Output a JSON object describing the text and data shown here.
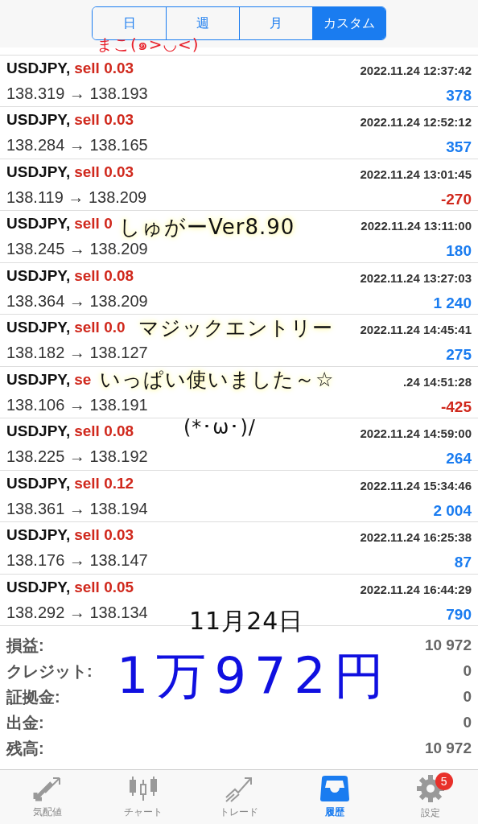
{
  "period_tabs": [
    {
      "label": "日",
      "selected": false
    },
    {
      "label": "週",
      "selected": false
    },
    {
      "label": "月",
      "selected": false
    },
    {
      "label": "カスタム",
      "selected": true
    }
  ],
  "deals": [
    {
      "symbol": "USDJPY,",
      "side": "sell 0.03",
      "time": "2022.11.24 12:37:42",
      "prices": "138.319 → 138.193",
      "profit": "378",
      "negative": false
    },
    {
      "symbol": "USDJPY,",
      "side": "sell 0.03",
      "time": "2022.11.24 12:52:12",
      "prices": "138.284 → 138.165",
      "profit": "357",
      "negative": false
    },
    {
      "symbol": "USDJPY,",
      "side": "sell 0.03",
      "time": "2022.11.24 13:01:45",
      "prices": "138.119 → 138.209",
      "profit": "-270",
      "negative": true
    },
    {
      "symbol": "USDJPY,",
      "side": "sell 0",
      "time": "2022.11.24 13:11:00",
      "prices": "138.245 → 138.209",
      "profit": "180",
      "negative": false
    },
    {
      "symbol": "USDJPY,",
      "side": "sell 0.08",
      "time": "2022.11.24 13:27:03",
      "prices": "138.364 → 138.209",
      "profit": "1 240",
      "negative": false
    },
    {
      "symbol": "USDJPY,",
      "side": "sell 0.0",
      "time": "2022.11.24 14:45:41",
      "prices": "138.182 → 138.127",
      "profit": "275",
      "negative": false
    },
    {
      "symbol": "USDJPY,",
      "side": "se",
      "time": ".24 14:51:28",
      "prices": "138.106 → 138.191",
      "profit": "-425",
      "negative": true
    },
    {
      "symbol": "USDJPY,",
      "side": "sell 0.08",
      "time": "2022.11.24 14:59:00",
      "prices": "138.225 → 138.192",
      "profit": "264",
      "negative": false
    },
    {
      "symbol": "USDJPY,",
      "side": "sell 0.12",
      "time": "2022.11.24 15:34:46",
      "prices": "138.361 → 138.194",
      "profit": "2 004",
      "negative": false
    },
    {
      "symbol": "USDJPY,",
      "side": "sell 0.03",
      "time": "2022.11.24 16:25:38",
      "prices": "138.176 → 138.147",
      "profit": "87",
      "negative": false
    },
    {
      "symbol": "USDJPY,",
      "side": "sell 0.05",
      "time": "2022.11.24 16:44:29",
      "prices": "138.292 → 138.134",
      "profit": "790",
      "negative": false
    }
  ],
  "summary": [
    {
      "label": "損益:",
      "value": "10 972"
    },
    {
      "label": "クレジット:",
      "value": "0"
    },
    {
      "label": "証拠金:",
      "value": "0"
    },
    {
      "label": "出金:",
      "value": "0"
    },
    {
      "label": "残高:",
      "value": "10 972"
    }
  ],
  "notes": [
    {
      "text": "まこ(๑>◡<)",
      "color": "#e8202a"
    },
    {
      "text": "しゅがーVer8.90",
      "color": "#111111"
    },
    {
      "text": "マジックエントリー",
      "color": "#111111"
    },
    {
      "text": "いっぱい使いました～☆",
      "color": "#111111"
    },
    {
      "text": "(*･ω･)/",
      "color": "#111111"
    },
    {
      "text": "11月24日",
      "color": "#111111"
    },
    {
      "text": "1万972円",
      "color": "#1010e0"
    }
  ],
  "tab_bar": [
    {
      "label": "気配値",
      "selected": false
    },
    {
      "label": "チャート",
      "selected": false
    },
    {
      "label": "トレード",
      "selected": false
    },
    {
      "label": "履歴",
      "selected": true
    },
    {
      "label": "設定",
      "selected": false,
      "badge": "5"
    }
  ]
}
